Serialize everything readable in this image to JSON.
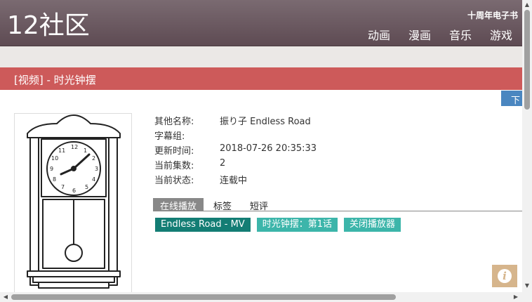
{
  "header": {
    "logo": "12社区",
    "ebook_link": "十周年电子书",
    "nav": [
      "动画",
      "漫画",
      "音乐",
      "游戏"
    ]
  },
  "title_bar": {
    "title": "[视频] - 时光钟摆"
  },
  "download_button": {
    "label": "下"
  },
  "details": {
    "rows": [
      {
        "label": "其他名称:",
        "value": "振り子 Endless Road"
      },
      {
        "label": "字幕组:",
        "value": ""
      },
      {
        "label": "更新时间:",
        "value": "2018-07-26 20:35:33"
      },
      {
        "label": "当前集数:",
        "value": "2"
      },
      {
        "label": "当前状态:",
        "value": "连载中"
      }
    ]
  },
  "tabs": [
    {
      "label": "在线播放",
      "active": true
    },
    {
      "label": "标签",
      "active": false
    },
    {
      "label": "短评",
      "active": false
    }
  ],
  "episodes": [
    {
      "label": "Endless Road - MV",
      "color": "#137d74"
    },
    {
      "label": "时光钟摆：第1话",
      "color": "#3cb5aa"
    },
    {
      "label": "关闭播放器",
      "color": "#3cb5aa"
    }
  ],
  "colors": {
    "header": "#6a575e",
    "title_bar": "#cd5a5a",
    "download": "#4a86c0",
    "info_button": "#d6b58c"
  },
  "icons": {
    "cover": "pendulum-clock-drawing",
    "info": "info-icon"
  }
}
